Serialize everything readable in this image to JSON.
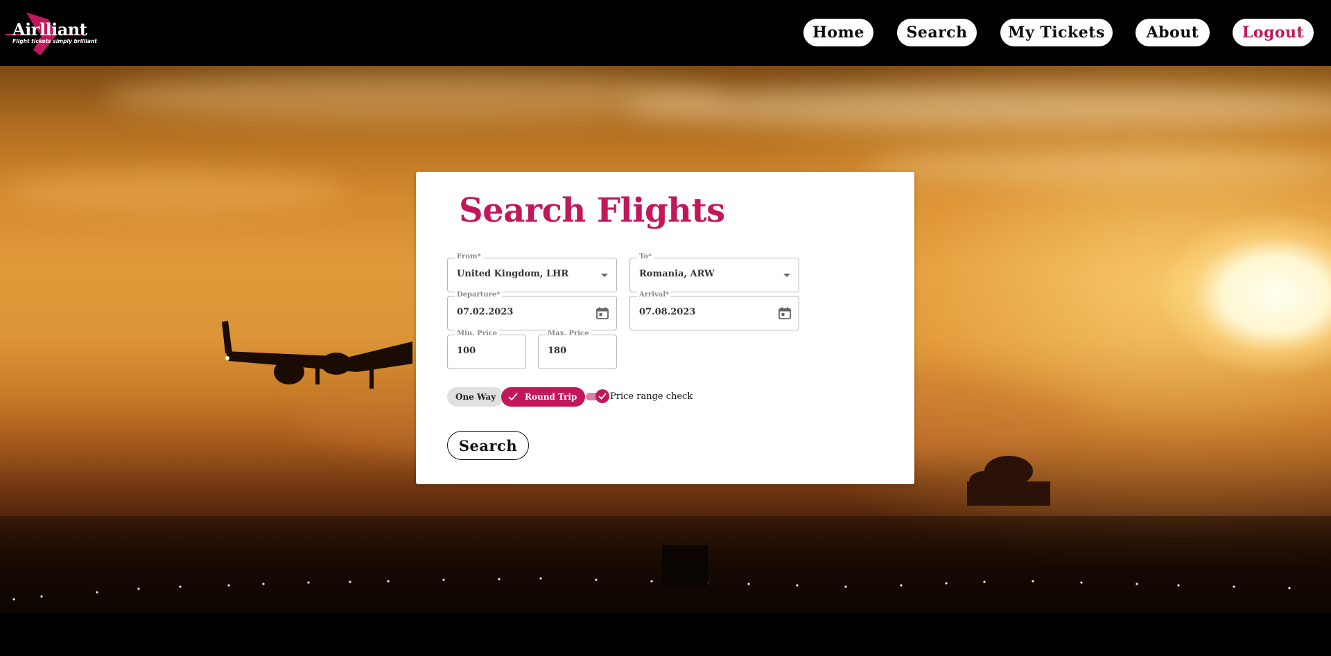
{
  "brand": {
    "name": "Airlliant",
    "tagline": "Flight tickets simply brilliant",
    "accent": "#c2185b"
  },
  "nav": {
    "items": [
      {
        "label": "Home"
      },
      {
        "label": "Search"
      },
      {
        "label": "My Tickets"
      },
      {
        "label": "About"
      },
      {
        "label": "Logout"
      }
    ]
  },
  "search": {
    "title": "Search Flights",
    "from": {
      "label": "From*",
      "value": "United Kingdom, LHR"
    },
    "to": {
      "label": "To*",
      "value": "Romania, ARW"
    },
    "departure": {
      "label": "Departure*",
      "value": "07.02.2023"
    },
    "arrival": {
      "label": "Arrival*",
      "value": "07.08.2023"
    },
    "min_price": {
      "label": "Min. Price",
      "value": "100"
    },
    "max_price": {
      "label": "Max. Price",
      "value": "180"
    },
    "trip_type": {
      "one_way": "One Way",
      "round_trip": "Round Trip",
      "selected": "Round Trip"
    },
    "price_range_check": {
      "label": "Price range check",
      "checked": true
    },
    "submit_label": "Search"
  }
}
